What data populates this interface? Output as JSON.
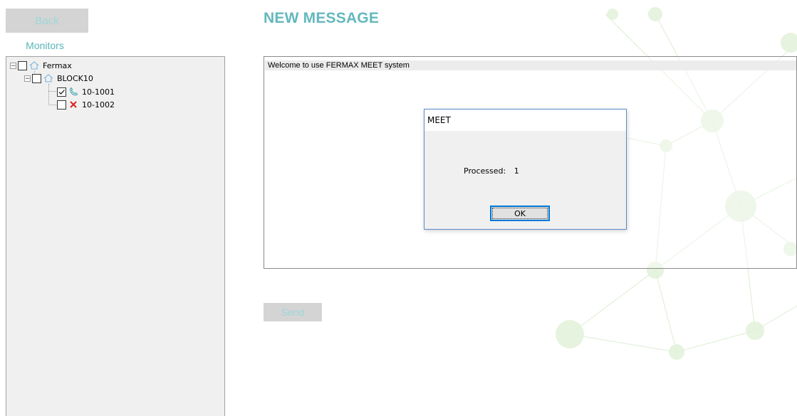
{
  "back_button": {
    "label": "Back"
  },
  "sidebar": {
    "label": "Monitors",
    "tree": {
      "root": {
        "label": "Fermax",
        "checked": false,
        "icon": "house-icon"
      },
      "block": {
        "label": "BLOCK10",
        "checked": false,
        "icon": "house-icon"
      },
      "items": [
        {
          "label": "10-1001",
          "checked": true,
          "icon": "phone-icon"
        },
        {
          "label": "10-1002",
          "checked": false,
          "icon": "cross-icon"
        }
      ]
    }
  },
  "main": {
    "title": "NEW MESSAGE",
    "message_text": "Welcome to use FERMAX MEET system",
    "send_label": "Send"
  },
  "dialog": {
    "title": "MEET",
    "processed_label": "Processed:",
    "processed_value": "1",
    "ok_label": "OK"
  },
  "colors": {
    "accent": "#64b8bd",
    "button_bg": "#d4d4d4",
    "button_text": "#9fd6d8",
    "dialog_border": "#5a8bc5"
  }
}
